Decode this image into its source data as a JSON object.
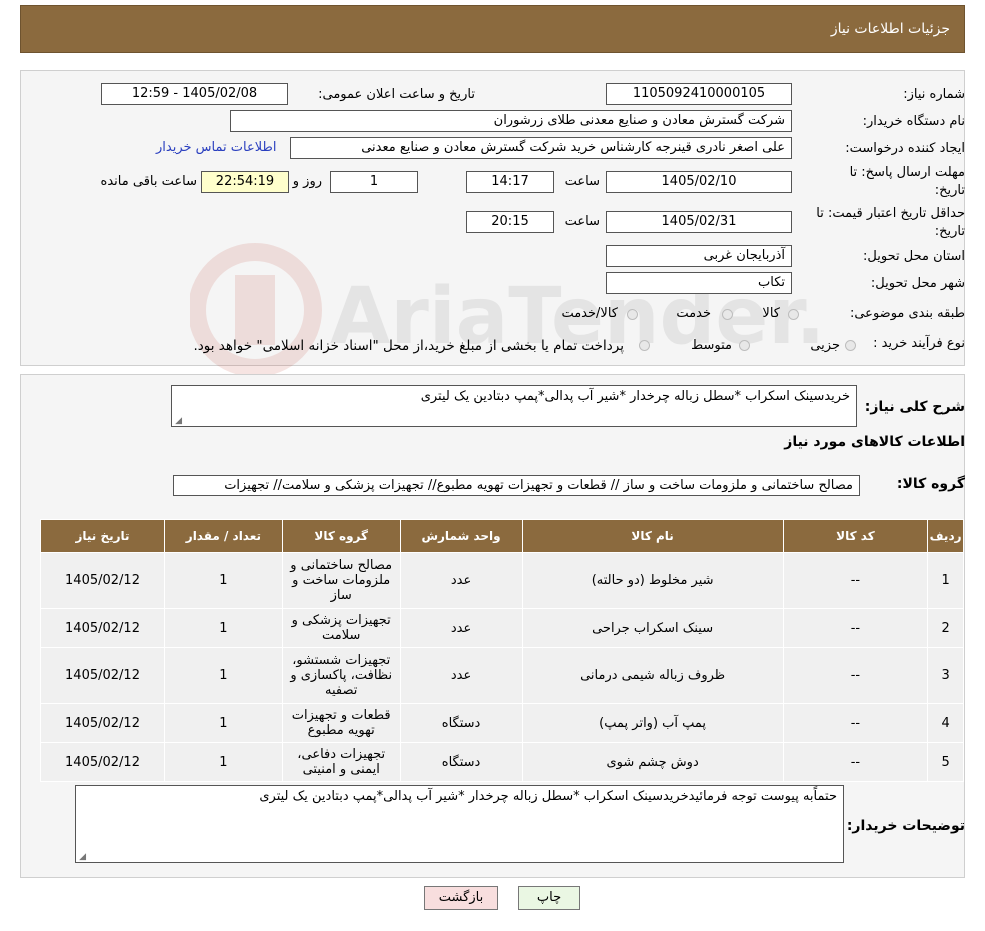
{
  "header": {
    "title": "جزئیات اطلاعات نیاز"
  },
  "watermark": {
    "text": "AriaTender.neT"
  },
  "info": {
    "need_number_label": "شماره نیاز:",
    "need_number": "1105092410000105",
    "announce_label": "تاریخ و ساعت اعلان عمومی:",
    "announce_value": "1405/02/08 - 12:59",
    "buyer_label": "نام دستگاه خریدار:",
    "buyer_value": "شرکت گسترش معادن و صنایع معدنی طلای زرشوران",
    "creator_label": "ایجاد کننده درخواست:",
    "creator_value": "علی اصغر نادری قینرجه کارشناس خرید  شرکت گسترش معادن و صنایع معدنی",
    "contact_link": "اطلاعات تماس خریدار",
    "deadline_label_1": "مهلت ارسال پاسخ: تا",
    "deadline_label_2": "تاریخ:",
    "deadline_date": "1405/02/10",
    "time_label": "ساعت",
    "deadline_time": "14:17",
    "days_value": "1",
    "days_label": "روز و",
    "remaining_time": "22:54:19",
    "remaining_label": "ساعت باقی مانده",
    "validity_label_1": "حداقل تاریخ اعتبار قیمت: تا",
    "validity_label_2": "تاریخ:",
    "validity_date": "1405/02/31",
    "validity_time": "20:15",
    "province_label": "استان محل تحویل:",
    "province_value": "آذربایجان غربی",
    "city_label": "شهر محل تحویل:",
    "city_value": "تکاب",
    "category_label": "طبقه بندی موضوعی:",
    "category_options": [
      "کالا",
      "خدمت",
      "کالا/خدمت"
    ],
    "process_label": "نوع فرآیند خرید :",
    "process_options": [
      "جزیی",
      "متوسط"
    ],
    "process_note": "پرداخت تمام یا بخشی از مبلغ خرید،از محل \"اسناد خزانه اسلامی\" خواهد بود."
  },
  "summary": {
    "label": "شرح کلی نیاز:",
    "value": "خریدسینک اسکراب *سطل زباله چرخدار *شیر آب پدالی*پمپ دبتادین یک لیتری"
  },
  "goods": {
    "section_title": "اطلاعات کالاهای مورد نیاز",
    "group_label": "گروه کالا:",
    "group_value": "مصالح ساختمانی و ملزومات ساخت و ساز //  قطعات و تجهیزات تهویه مطبوع// تجهیزات پزشکی و سلامت// تجهیزات",
    "columns": [
      "ردیف",
      "کد کالا",
      "نام کالا",
      "واحد شمارش",
      "گروه کالا",
      "تعداد / مقدار",
      "تاریخ نیاز"
    ],
    "rows": [
      {
        "row": "1",
        "code": "--",
        "name": "شیر مخلوط (دو حالته)",
        "unit": "عدد",
        "group": "مصالح ساختمانی و ملزومات ساخت و ساز",
        "qty": "1",
        "date": "1405/02/12"
      },
      {
        "row": "2",
        "code": "--",
        "name": "سینک اسکراب جراحی",
        "unit": "عدد",
        "group": "تجهیزات پزشکی و سلامت",
        "qty": "1",
        "date": "1405/02/12"
      },
      {
        "row": "3",
        "code": "--",
        "name": "ظروف زباله شیمی درمانی",
        "unit": "عدد",
        "group": "تجهیزات شستشو، نظافت، پاکسازی و تصفیه",
        "qty": "1",
        "date": "1405/02/12"
      },
      {
        "row": "4",
        "code": "--",
        "name": "پمپ آب (واتر پمپ)",
        "unit": "دستگاه",
        "group": "قطعات و تجهیزات تهویه مطبوع",
        "qty": "1",
        "date": "1405/02/12"
      },
      {
        "row": "5",
        "code": "--",
        "name": "دوش چشم شوی",
        "unit": "دستگاه",
        "group": "تجهیزات دفاعی، ایمنی و امنیتی",
        "qty": "1",
        "date": "1405/02/12"
      }
    ],
    "notes_label": "توضیحات خریدار:",
    "notes_value": "حتماًبه پیوست توجه فرمائیدخریدسینک اسکراب *سطل زباله چرخدار *شیر آب پدالی*پمپ دبتادین یک لیتری"
  },
  "buttons": {
    "print": "چاپ",
    "back": "بازگشت"
  },
  "colors": {
    "header_bg": "#8b6a3e",
    "link": "#2a3fbf",
    "highlight": "#ffffcc",
    "back_button": "#f8dede",
    "print_button": "#eaf7e3"
  }
}
